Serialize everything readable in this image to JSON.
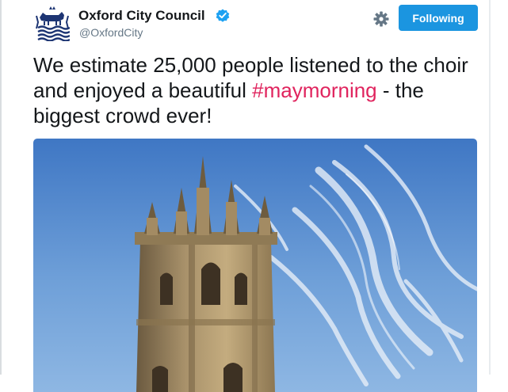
{
  "account": {
    "name": "Oxford City Council",
    "handle": "@OxfordCity",
    "avatar_icon": "oxford-crest-icon",
    "verified_icon": "verified-badge-icon"
  },
  "actions": {
    "settings_icon": "gear-icon",
    "follow_label": "Following"
  },
  "tweet": {
    "text_before": "We estimate 25,000 people listened to the choir and enjoyed a beautiful ",
    "hashtag": "#maymorning",
    "text_after": " - the biggest crowd ever!"
  },
  "colors": {
    "follow_button": "#1b95e0",
    "hashtag": "#e0245e",
    "verified": "#1da1f2",
    "crest": "#1d3573"
  }
}
